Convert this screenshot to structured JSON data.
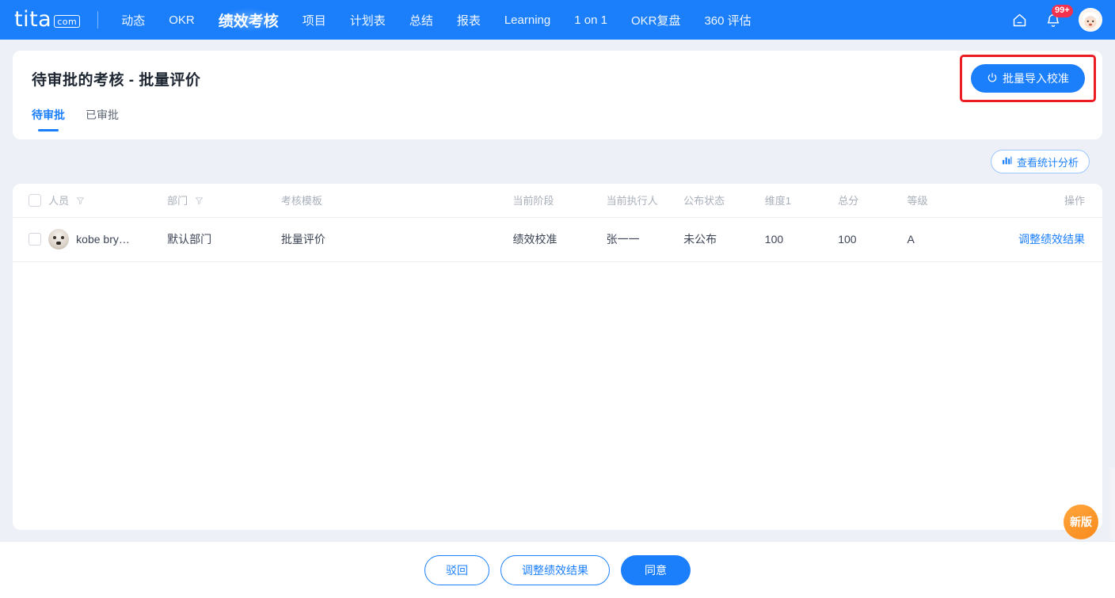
{
  "brand": {
    "name": "tita",
    "suffix": "com",
    "accent": "#1b7ffb"
  },
  "topnav": {
    "items": [
      {
        "label": "动态",
        "active": false
      },
      {
        "label": "OKR",
        "active": false
      },
      {
        "label": "绩效考核",
        "active": true
      },
      {
        "label": "项目",
        "active": false
      },
      {
        "label": "计划表",
        "active": false
      },
      {
        "label": "总结",
        "active": false
      },
      {
        "label": "报表",
        "active": false
      },
      {
        "label": "Learning",
        "active": false
      },
      {
        "label": "1 on 1",
        "active": false
      },
      {
        "label": "OKR复盘",
        "active": false
      },
      {
        "label": "360 评估",
        "active": false
      }
    ],
    "home_icon": "home-icon",
    "bell_icon": "bell-icon",
    "notification_count": "99+",
    "avatar": "user-avatar"
  },
  "header": {
    "title": "待审批的考核 - 批量评价",
    "tabs": [
      {
        "label": "待审批",
        "active": true
      },
      {
        "label": "已审批",
        "active": false
      }
    ],
    "import_button": {
      "label": "批量导入校准",
      "icon": "power-import-icon"
    },
    "highlight_color": "#ec1c24"
  },
  "toolbar": {
    "stats_button": {
      "label": "查看统计分析",
      "icon": "bar-chart-icon"
    }
  },
  "table": {
    "columns": [
      {
        "key": "checkbox",
        "label": "",
        "filter": false
      },
      {
        "key": "person",
        "label": "人员",
        "filter": true
      },
      {
        "key": "dept",
        "label": "部门",
        "filter": true
      },
      {
        "key": "template",
        "label": "考核模板",
        "filter": false
      },
      {
        "key": "stage",
        "label": "当前阶段",
        "filter": false
      },
      {
        "key": "executor",
        "label": "当前执行人",
        "filter": false
      },
      {
        "key": "publish",
        "label": "公布状态",
        "filter": false
      },
      {
        "key": "dim1",
        "label": "维度1",
        "filter": false
      },
      {
        "key": "total",
        "label": "总分",
        "filter": false
      },
      {
        "key": "grade",
        "label": "等级",
        "filter": false
      },
      {
        "key": "action",
        "label": "操作",
        "filter": false
      }
    ],
    "rows": [
      {
        "checked": false,
        "avatar": "dog-avatar",
        "person": "kobe bry…",
        "dept": "默认部门",
        "template": "批量评价",
        "stage": "绩效校准",
        "executor": "张一一",
        "publish": "未公布",
        "dim1": "100",
        "total": "100",
        "grade": "A",
        "action": "调整绩效结果"
      }
    ]
  },
  "footer": {
    "buttons": [
      {
        "label": "驳回",
        "style": "outline"
      },
      {
        "label": "调整绩效结果",
        "style": "outline"
      },
      {
        "label": "同意",
        "style": "fill"
      }
    ]
  },
  "floating": {
    "new_version": {
      "label": "新版",
      "color": "#f98a1c"
    },
    "service": {
      "icon": "headset-support-icon",
      "color": "#1b7ffb"
    }
  }
}
